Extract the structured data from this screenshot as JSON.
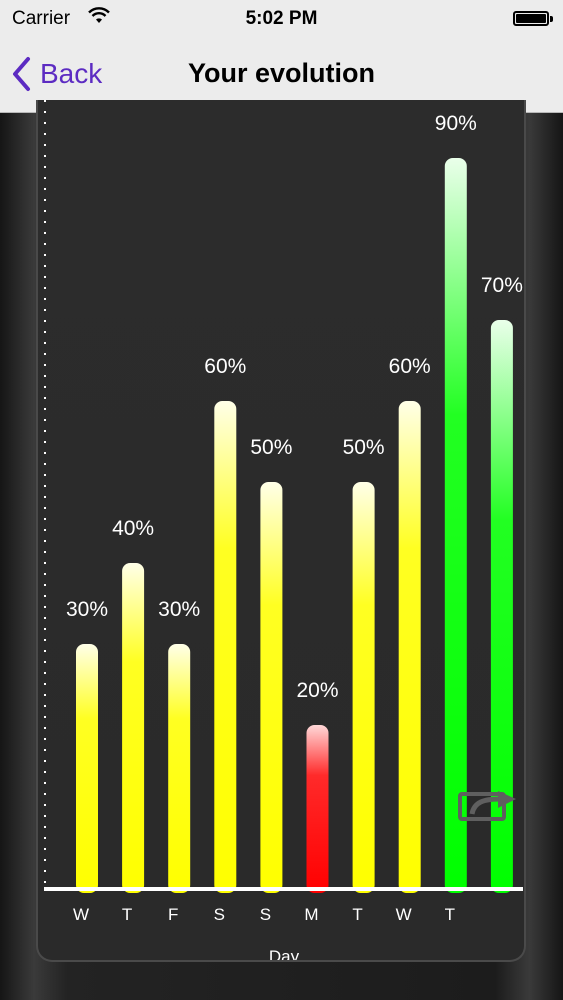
{
  "status_bar": {
    "carrier": "Carrier",
    "time": "5:02 PM"
  },
  "nav": {
    "back_label": "Back",
    "title": "Your evolution"
  },
  "icons": {
    "back": "chevron-left-icon",
    "share": "share-icon",
    "wifi": "wifi-icon",
    "battery": "battery-icon"
  },
  "colors": {
    "accent": "#5c2bc2",
    "yellow": "#ffff00",
    "red": "#ff0000",
    "green": "#00ff00"
  },
  "chart_data": {
    "type": "bar",
    "categories": [
      "W",
      "T",
      "F",
      "S",
      "S",
      "M",
      "T",
      "W",
      "T",
      ""
    ],
    "values": [
      30,
      40,
      30,
      60,
      50,
      20,
      50,
      60,
      90,
      70
    ],
    "data_labels": [
      "30%",
      "40%",
      "30%",
      "60%",
      "50%",
      "20%",
      "50%",
      "60%",
      "90%",
      "70%"
    ],
    "bar_colors": [
      "yellow",
      "yellow",
      "yellow",
      "yellow",
      "yellow",
      "red",
      "yellow",
      "yellow",
      "green",
      "green"
    ],
    "xlabel": "Day",
    "ylabel": "",
    "ylim": [
      0,
      90
    ],
    "grid": false,
    "legend": "none"
  }
}
